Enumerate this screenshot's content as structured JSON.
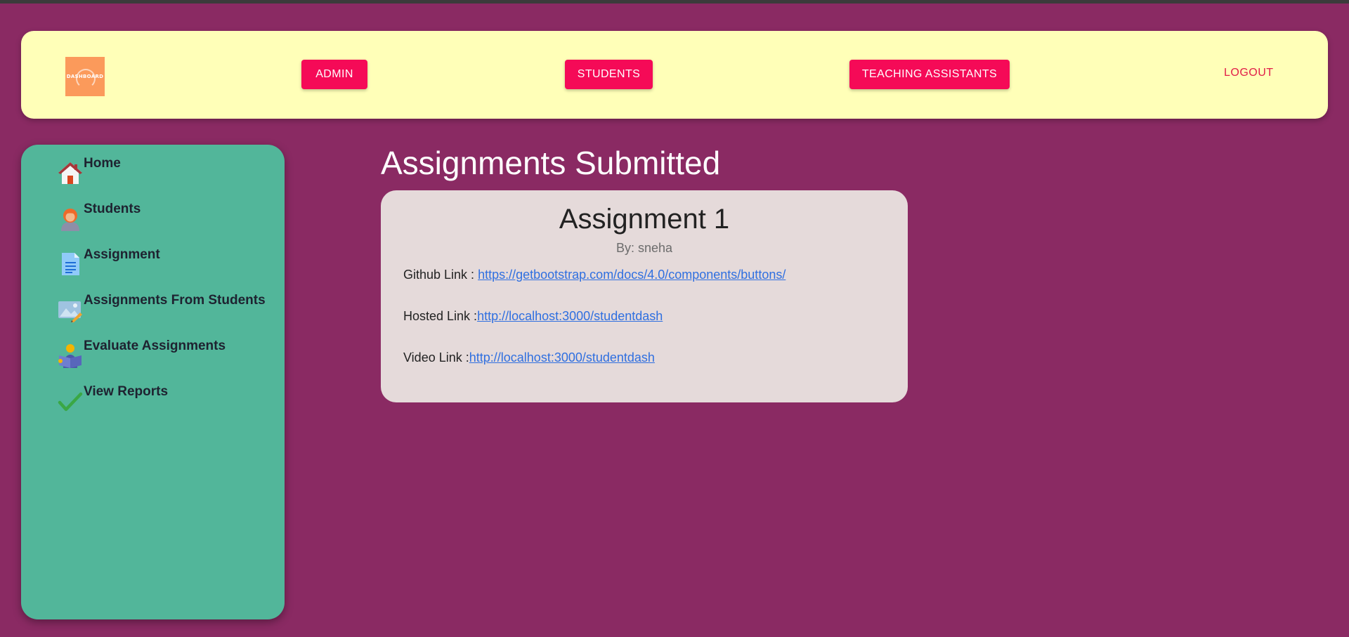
{
  "header": {
    "logo_text": "DASHBOARD",
    "nav": {
      "admin": "ADMIN",
      "students": "STUDENTS",
      "teaching_assistants": "TEACHING ASSISTANTS"
    },
    "logout": "LOGOUT"
  },
  "sidebar": {
    "items": [
      {
        "label": "Home",
        "icon": "house-icon"
      },
      {
        "label": "Students",
        "icon": "student-icon"
      },
      {
        "label": "Assignment",
        "icon": "document-icon"
      },
      {
        "label": "Assignments From Students",
        "icon": "image-edit-icon"
      },
      {
        "label": "Evaluate Assignments",
        "icon": "reader-icon"
      },
      {
        "label": "View Reports",
        "icon": "checkmark-icon"
      }
    ]
  },
  "main": {
    "page_title": "Assignments Submitted",
    "card": {
      "title": "Assignment 1",
      "author": "By: sneha",
      "github_label": "Github Link :",
      "github_url": "https://getbootstrap.com/docs/4.0/components/buttons/",
      "hosted_label": "Hosted Link :",
      "hosted_url": "http://localhost:3000/studentdash",
      "video_label": "Video Link :",
      "video_url": "http://localhost:3000/studentdash"
    }
  },
  "colors": {
    "background": "#8a2a63",
    "header_bg": "#ffffb8",
    "sidebar_bg": "#52b69a",
    "button_bg": "#f50a57",
    "card_bg": "#e5dada",
    "link": "#2f6fe0"
  }
}
